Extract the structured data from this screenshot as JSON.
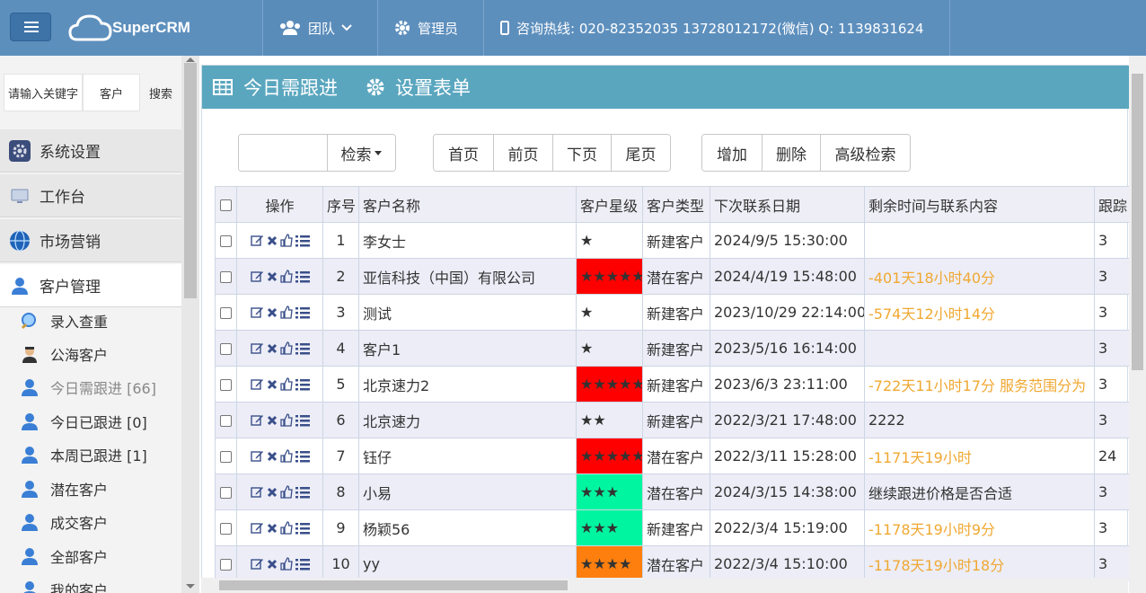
{
  "app": {
    "logo_text": "SuperCRM"
  },
  "nav": {
    "team": "团队",
    "admin": "管理员",
    "hotline": "咨询热线: 020-82352035 13728012172(微信) Q: 1139831624"
  },
  "sidebar": {
    "search_placeholder": "请输入关键字",
    "search_type": "客户",
    "search_button": "搜索",
    "sections": [
      {
        "label": "系统设置",
        "icon": "gear-icon"
      },
      {
        "label": "工作台",
        "icon": "monitor-icon"
      },
      {
        "label": "市场营销",
        "icon": "globe-icon"
      },
      {
        "label": "客户管理",
        "icon": "user-icon"
      }
    ],
    "items": [
      {
        "label": "录入查重",
        "icon": "magnifier-icon"
      },
      {
        "label": "公海客户",
        "icon": "agent-icon"
      },
      {
        "label": "今日需跟进 [66]",
        "icon": "user-icon"
      },
      {
        "label": "今日已跟进 [0]",
        "icon": "user-icon"
      },
      {
        "label": "本周已跟进 [1]",
        "icon": "user-icon"
      },
      {
        "label": "潜在客户",
        "icon": "user-icon"
      },
      {
        "label": "成交客户",
        "icon": "user-icon"
      },
      {
        "label": "全部客户",
        "icon": "user-icon"
      },
      {
        "label": "我的客户",
        "icon": "user-icon"
      }
    ]
  },
  "panel": {
    "title": "今日需跟进",
    "settings": "设置表单",
    "search_button": "检索",
    "pager": [
      "首页",
      "前页",
      "下页",
      "尾页"
    ],
    "actions": [
      "增加",
      "删除",
      "高级检索"
    ]
  },
  "table": {
    "headers": [
      "操作",
      "序号",
      "客户名称",
      "客户星级",
      "客户类型",
      "下次联系日期",
      "剩余时间与联系内容",
      "跟踪"
    ],
    "rows": [
      {
        "no": "1",
        "name": "李女士",
        "stars": "★",
        "star_bg": "",
        "type": "新建客户",
        "date": "2024/9/5 15:30:00",
        "remain": "",
        "warn": false,
        "track": "3"
      },
      {
        "no": "2",
        "name": "亚信科技（中国）有限公司",
        "stars": "★★★★★",
        "star_bg": "#ff0000",
        "type": "潜在客户",
        "date": "2024/4/19 15:48:00",
        "remain": "-401天18小时40分",
        "warn": true,
        "track": "3"
      },
      {
        "no": "3",
        "name": "测试",
        "stars": "★",
        "star_bg": "",
        "type": "新建客户",
        "date": "2023/10/29 22:14:00",
        "remain": "-574天12小时14分",
        "warn": true,
        "track": "3"
      },
      {
        "no": "4",
        "name": "客户1",
        "stars": "★",
        "star_bg": "",
        "type": "新建客户",
        "date": "2023/5/16 16:14:00",
        "remain": "",
        "warn": false,
        "track": "3"
      },
      {
        "no": "5",
        "name": "北京速力2",
        "stars": "★★★★★",
        "star_bg": "#ff0000",
        "type": "新建客户",
        "date": "2023/6/3 23:11:00",
        "remain": "-722天11小时17分 服务范围分为",
        "warn": true,
        "track": "3"
      },
      {
        "no": "6",
        "name": "北京速力",
        "stars": "★★",
        "star_bg": "",
        "type": "新建客户",
        "date": "2022/3/21 17:48:00",
        "remain": "2222",
        "warn": false,
        "track": "3"
      },
      {
        "no": "7",
        "name": "钰仔",
        "stars": "★★★★★",
        "star_bg": "#ff0000",
        "type": "潜在客户",
        "date": "2022/3/11 15:28:00",
        "remain": "-1171天19小时",
        "warn": true,
        "track": "24"
      },
      {
        "no": "8",
        "name": "小易",
        "stars": "★★★",
        "star_bg": "#00f5a0",
        "type": "潜在客户",
        "date": "2024/3/15 14:38:00",
        "remain": "继续跟进价格是否合适",
        "warn": false,
        "track": "3"
      },
      {
        "no": "9",
        "name": "杨颖56",
        "stars": "★★★",
        "star_bg": "#00f5a0",
        "type": "新建客户",
        "date": "2022/3/4 15:19:00",
        "remain": "-1178天19小时9分",
        "warn": true,
        "track": "3"
      },
      {
        "no": "10",
        "name": "yy",
        "stars": "★★★★",
        "star_bg": "#ff7f0e",
        "type": "潜在客户",
        "date": "2022/3/4 15:10:00",
        "remain": "-1178天19小时18分",
        "warn": true,
        "track": "3"
      }
    ]
  }
}
